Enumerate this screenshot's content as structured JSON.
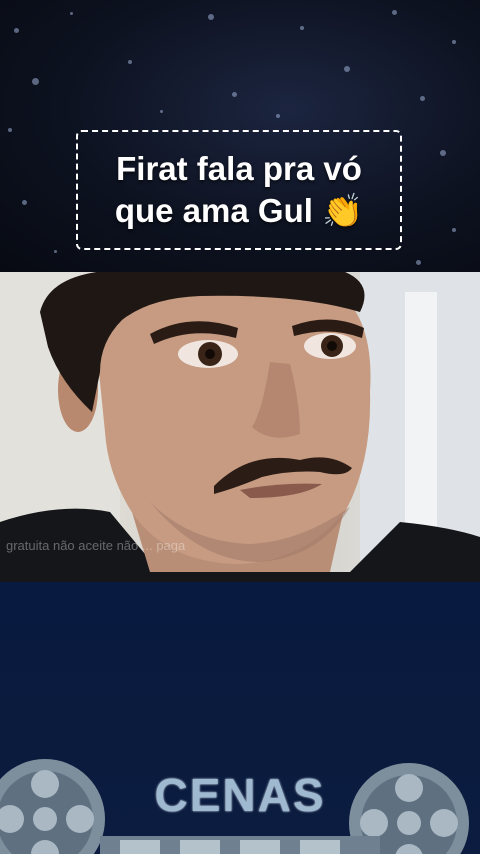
{
  "caption": {
    "line1": "Firat fala pra vó",
    "line2": "que ama Gul 👏"
  },
  "video": {
    "watermark_text": "gratuita não aceite não ... paga"
  },
  "branding": {
    "label": "CENAS"
  },
  "colors": {
    "top_background": "#0d1220",
    "bottom_background": "#0a1b3e",
    "caption_text": "#ffffff",
    "brand_text": "#9fb9d0"
  }
}
